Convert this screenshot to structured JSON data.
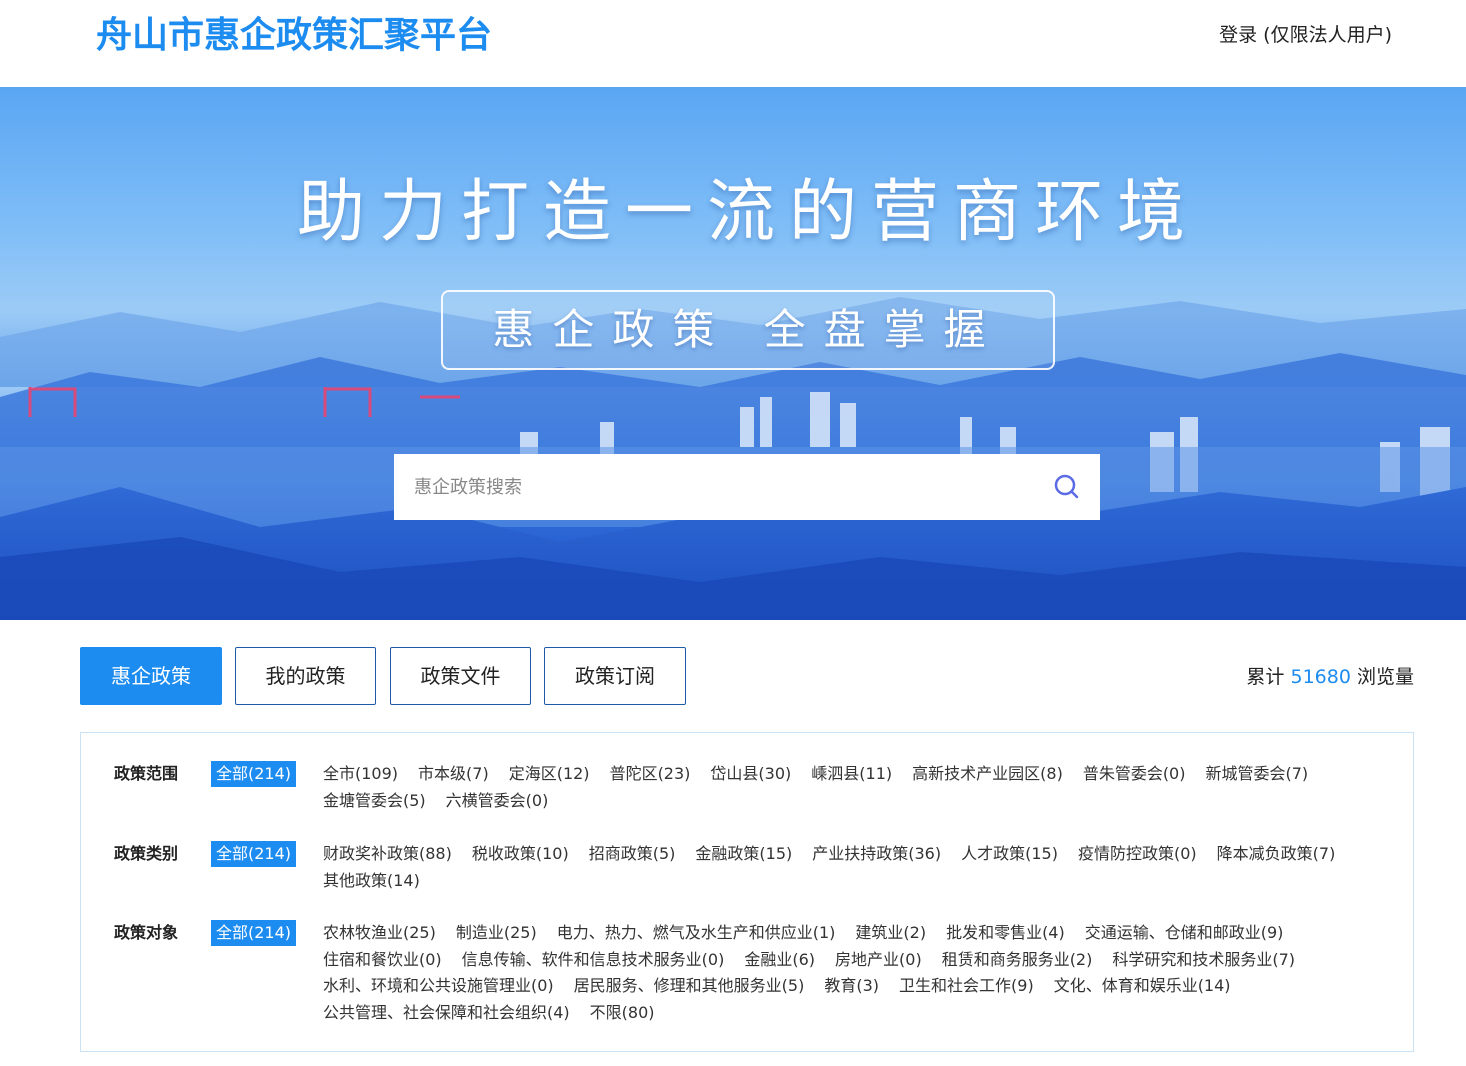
{
  "header": {
    "site_title": "舟山市惠企政策汇聚平台",
    "login_label": "登录 (仅限法人用户)"
  },
  "banner": {
    "slogan_main": "助力打造一流的营商环境",
    "slogan_sub": "惠企政策  全盘掌握",
    "search": {
      "placeholder": "惠企政策搜索",
      "value": "",
      "icon": "search-icon"
    }
  },
  "tabs": [
    {
      "label": "惠企政策",
      "active": true
    },
    {
      "label": "我的政策",
      "active": false
    },
    {
      "label": "政策文件",
      "active": false
    },
    {
      "label": "政策订阅",
      "active": false
    }
  ],
  "views": {
    "prefix": "累计",
    "count": "51680",
    "suffix": "浏览量"
  },
  "filters": {
    "scope": {
      "label": "政策范围",
      "all": "全部(214)",
      "options": [
        "全市(109)",
        "市本级(7)",
        "定海区(12)",
        "普陀区(23)",
        "岱山县(30)",
        "嵊泗县(11)",
        "高新技术产业园区(8)",
        "普朱管委会(0)",
        "新城管委会(7)",
        "金塘管委会(5)",
        "六横管委会(0)"
      ]
    },
    "category": {
      "label": "政策类别",
      "all": "全部(214)",
      "options": [
        "财政奖补政策(88)",
        "税收政策(10)",
        "招商政策(5)",
        "金融政策(15)",
        "产业扶持政策(36)",
        "人才政策(15)",
        "疫情防控政策(0)",
        "降本减负政策(7)",
        "其他政策(14)"
      ]
    },
    "target": {
      "label": "政策对象",
      "all": "全部(214)",
      "options": [
        "农林牧渔业(25)",
        "制造业(25)",
        "电力、热力、燃气及水生产和供应业(1)",
        "建筑业(2)",
        "批发和零售业(4)",
        "交通运输、仓储和邮政业(9)",
        "住宿和餐饮业(0)",
        "信息传输、软件和信息技术服务业(0)",
        "金融业(6)",
        "房地产业(0)",
        "租赁和商务服务业(2)",
        "科学研究和技术服务业(7)",
        "水利、环境和公共设施管理业(0)",
        "居民服务、修理和其他服务业(5)",
        "教育(3)",
        "卫生和社会工作(9)",
        "文化、体育和娱乐业(14)",
        "公共管理、社会保障和社会组织(4)",
        "不限(80)"
      ]
    }
  },
  "colors": {
    "accent": "#1d8cf0",
    "tab_border": "#1d5ba8",
    "panel_border": "#c9e2f5"
  }
}
